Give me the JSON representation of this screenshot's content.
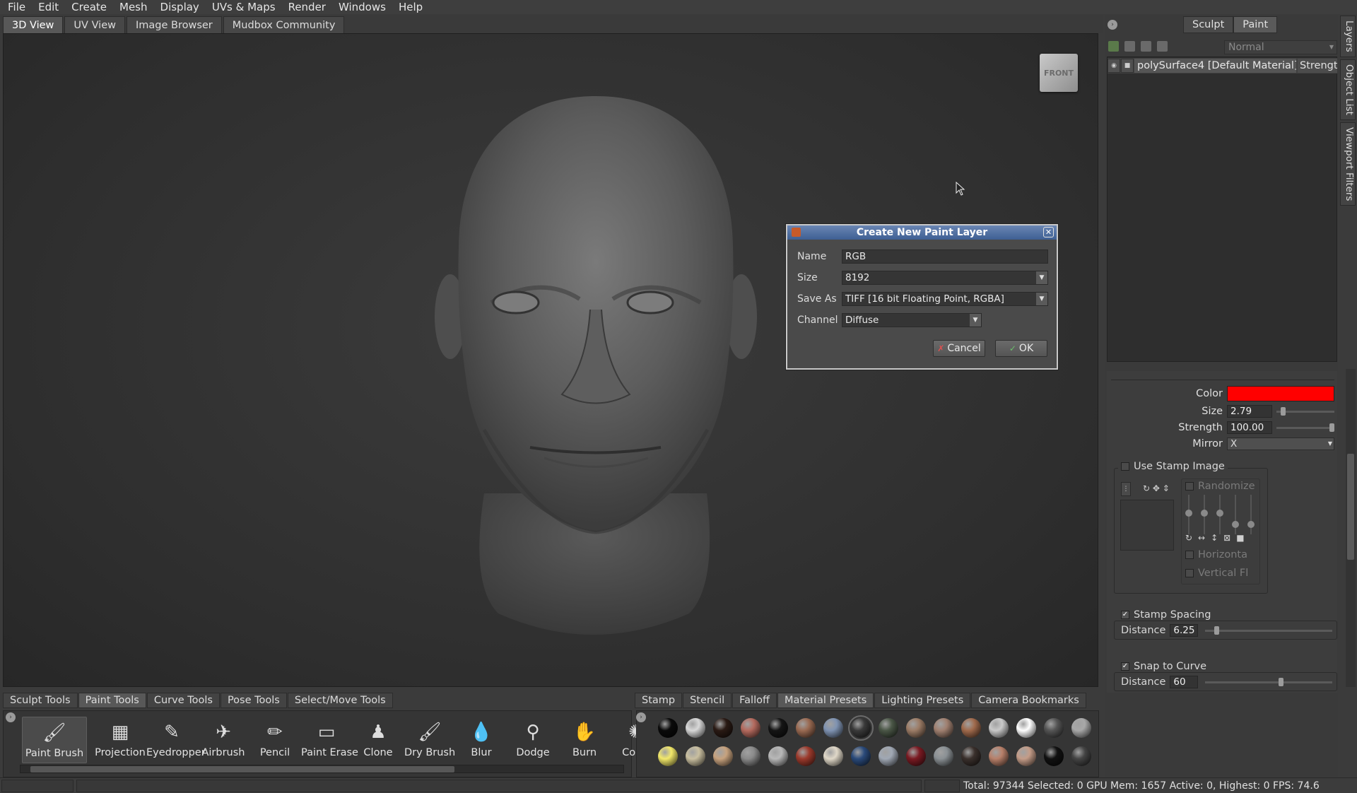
{
  "menu": [
    "File",
    "Edit",
    "Create",
    "Mesh",
    "Display",
    "UVs & Maps",
    "Render",
    "Windows",
    "Help"
  ],
  "view_tabs": [
    "3D View",
    "UV View",
    "Image Browser",
    "Mudbox Community"
  ],
  "viewcube_label": "FRONT",
  "dialog": {
    "title": "Create New Paint Layer",
    "name_label": "Name",
    "name_value": "RGB",
    "size_label": "Size",
    "size_value": "8192",
    "saveas_label": "Save As",
    "saveas_value": "TIFF [16 bit Floating Point, RGBA]",
    "channel_label": "Channel",
    "channel_value": "Diffuse",
    "cancel_label": "Cancel",
    "ok_label": "OK"
  },
  "right_tabs": [
    "Sculpt",
    "Paint"
  ],
  "blend_mode": "Normal",
  "layer": {
    "name": "polySurface4 [Default Material]",
    "strength": "Strengt"
  },
  "side_tabs": [
    "Layers",
    "Object List",
    "Viewport Filters"
  ],
  "props": {
    "color_label": "Color",
    "color_value": "#ff0000",
    "size_label": "Size",
    "size_value": "2.79",
    "size_level": 0.08,
    "strength_label": "Strength",
    "strength_value": "100.00",
    "strength_level": 1.0,
    "mirror_label": "Mirror",
    "mirror_value": "X",
    "use_stamp_label": "Use Stamp Image",
    "randomize_label": "Randomize",
    "horizontal_label": "Horizonta",
    "vertical_label": "Vertical Fl",
    "stamp_spacing_label": "Stamp Spacing",
    "distance_label": "Distance",
    "stamp_distance_value": "6.25",
    "stamp_distance_level": 0.07,
    "snap_curve_label": "Snap to Curve",
    "snap_distance_value": "60",
    "snap_distance_level": 0.6
  },
  "tool_tabs": [
    "Sculpt Tools",
    "Paint Tools",
    "Curve Tools",
    "Pose Tools",
    "Select/Move Tools"
  ],
  "tools": [
    {
      "label": "Paint Brush",
      "icon": "paint-brush-icon",
      "glyph": "🖌"
    },
    {
      "label": "Projection",
      "icon": "projection-icon",
      "glyph": "▦"
    },
    {
      "label": "Eyedropper",
      "icon": "eyedropper-icon",
      "glyph": "✎"
    },
    {
      "label": "Airbrush",
      "icon": "airbrush-icon",
      "glyph": "✈"
    },
    {
      "label": "Pencil",
      "icon": "pencil-icon",
      "glyph": "✏"
    },
    {
      "label": "Paint Erase",
      "icon": "eraser-icon",
      "glyph": "▭"
    },
    {
      "label": "Clone",
      "icon": "clone-stamp-icon",
      "glyph": "♟"
    },
    {
      "label": "Dry Brush",
      "icon": "dry-brush-icon",
      "glyph": "🖌"
    },
    {
      "label": "Blur",
      "icon": "blur-drop-icon",
      "glyph": "💧"
    },
    {
      "label": "Dodge",
      "icon": "dodge-icon",
      "glyph": "⚲"
    },
    {
      "label": "Burn",
      "icon": "burn-hand-icon",
      "glyph": "✋"
    },
    {
      "label": "Contr",
      "icon": "contrast-icon",
      "glyph": "✺"
    }
  ],
  "material_tabs": [
    "Stamp",
    "Stencil",
    "Falloff",
    "Material Presets",
    "Lighting Presets",
    "Camera Bookmarks"
  ],
  "materials_row1": [
    "#0a0a0a",
    "#d8d8d8",
    "#2a1a14",
    "#b46a5e",
    "#151515",
    "#9a6a52",
    "#7f93b2",
    "#3a3a3a",
    "#4a5646",
    "#9c7c66",
    "#a08070",
    "#a06a4c",
    "#c9c9c9",
    "#ffffff",
    "#555555",
    "#a8a8a8"
  ],
  "materials_row2": [
    "#f2e86a",
    "#c9bfa0",
    "#c7a27e",
    "#8a8a8a",
    "#b8b8b8",
    "#9c3a2c",
    "#e0d8c8",
    "#2a4a7a",
    "#a0a8b4",
    "#7a1a22",
    "#8a9094",
    "#3a302c",
    "#b8806a",
    "#c49c88",
    "#111111",
    "#444444"
  ],
  "status": "Total: 97344  Selected: 0 GPU Mem: 1657  Active: 0, Highest: 0  FPS: 74.6"
}
